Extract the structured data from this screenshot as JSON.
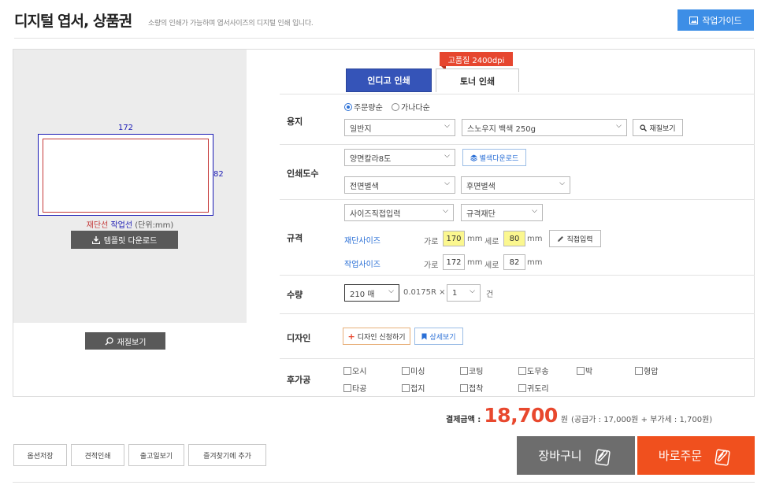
{
  "header": {
    "title": "디지털 엽서, 상품권",
    "subtitle": "소량의 인쇄가 가능하며 엽서사이즈의 디지털 인쇄 입니다.",
    "guide_button": "작업가이드"
  },
  "preview": {
    "width_label": "172",
    "height_label": "82",
    "cut_line_label": "재단선",
    "work_line_label": "작업선",
    "unit_label": "(단위:mm)",
    "template_download": "템플릿 다운로드",
    "zoom_button": "재질보기"
  },
  "tabs": {
    "badge": "고품질 2400dpi",
    "indigo": "인디고 인쇄",
    "toner": "토너 인쇄"
  },
  "paper": {
    "label": "용지",
    "radio_order": "주문량순",
    "radio_alpha": "가나다순",
    "type": "일반지",
    "stock": "스노우지 백색 250g",
    "view_button": "재질보기"
  },
  "color": {
    "label": "인쇄도수",
    "mode": "양면칼라8도",
    "spot_download": "별색다운로드",
    "front": "전면별색",
    "back": "후면별색"
  },
  "size": {
    "label": "규격",
    "input_type": "사이즈직접입력",
    "cut_type": "규격재단",
    "cut_size_label": "재단사이즈",
    "work_size_label": "작업사이즈",
    "width_text": "가로",
    "height_text": "세로",
    "mm": "mm",
    "cut_width": "170",
    "cut_height": "80",
    "work_width": "172",
    "work_height": "82",
    "direct_button": "직접입력"
  },
  "quantity": {
    "label": "수량",
    "sheets": "210 매",
    "rate": "0.0175R ×",
    "count": "1",
    "count_unit": "건"
  },
  "design": {
    "label": "디자인",
    "apply_button": "디자인 신청하기",
    "detail_button": "상세보기"
  },
  "finishing": {
    "label": "후가공",
    "options": [
      "오시",
      "미싱",
      "코팅",
      "도무송",
      "박",
      "형압",
      "타공",
      "접지",
      "접착",
      "귀도리"
    ]
  },
  "price": {
    "label": "결제금액 :",
    "amount": "18,700",
    "unit": "원",
    "detail": "(공급가 : 17,000원 + 부가세 : 1,700원)"
  },
  "bottom": {
    "save_option": "옵션저장",
    "quote_print": "견적인쇄",
    "release_date": "출고일보기",
    "add_favorite": "즐겨찾기에 추가",
    "cart": "장바구니",
    "order_now": "바로주문"
  },
  "colors": {
    "accent_blue": "#3d8ee6",
    "tab_indigo": "#3554b8",
    "badge_red": "#e6462f",
    "price_red": "#e8482e",
    "order_orange": "#f0501e",
    "cart_gray": "#6d6d6d",
    "highlight_yellow": "#fbf78f"
  }
}
